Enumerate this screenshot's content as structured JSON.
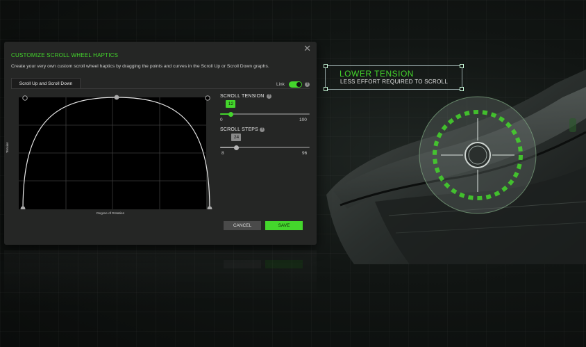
{
  "dialog": {
    "title": "CUSTOMIZE SCROLL WHEEL HAPTICS",
    "description": "Create your very own custom scroll wheel haptics by dragging the points and curves in the Scroll Up or Scroll Down graphs.",
    "close_glyph": "✕",
    "tab_label": "Scroll Up and Scroll Down",
    "link_label": "Link",
    "link_enabled": true,
    "graph": {
      "ylabel": "Tension",
      "xlabel": "Degree of Rotation"
    },
    "scroll_tension": {
      "label": "SCROLL TENSION",
      "value": 12,
      "min": 0,
      "max": 100
    },
    "scroll_steps": {
      "label": "SCROLL STEPS",
      "value": 24,
      "min": 8,
      "max": 96
    },
    "cancel_label": "CANCEL",
    "save_label": "SAVE",
    "info_glyph": "?"
  },
  "callout": {
    "headline": "LOWER TENSION",
    "subline": "LESS EFFORT REQUIRED TO SCROLL"
  },
  "colors": {
    "accent": "#44d62c",
    "dialog_bg": "#252625",
    "graph_bg": "#000000"
  },
  "icons": [
    "close-icon",
    "info-icon",
    "toggle-switch",
    "haptic-ring"
  ]
}
